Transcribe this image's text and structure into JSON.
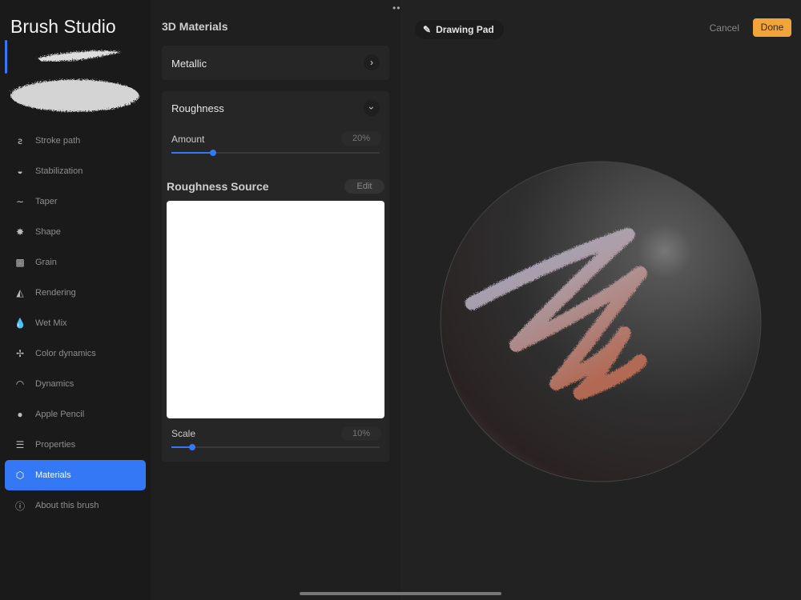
{
  "sidebar": {
    "title": "Brush Studio",
    "items": [
      {
        "label": "Stroke path",
        "icon": "stroke-path-icon",
        "glyph": "ꙅ"
      },
      {
        "label": "Stabilization",
        "icon": "stabilization-icon",
        "glyph": "◒"
      },
      {
        "label": "Taper",
        "icon": "taper-icon",
        "glyph": "∼"
      },
      {
        "label": "Shape",
        "icon": "shape-icon",
        "glyph": "✸"
      },
      {
        "label": "Grain",
        "icon": "grain-icon",
        "glyph": "▩"
      },
      {
        "label": "Rendering",
        "icon": "rendering-icon",
        "glyph": "◭"
      },
      {
        "label": "Wet Mix",
        "icon": "droplet-icon",
        "glyph": "💧"
      },
      {
        "label": "Color dynamics",
        "icon": "pinwheel-icon",
        "glyph": "✢"
      },
      {
        "label": "Dynamics",
        "icon": "gauge-icon",
        "glyph": "◠"
      },
      {
        "label": "Apple Pencil",
        "icon": "pencil-info-icon",
        "glyph": "●"
      },
      {
        "label": "Properties",
        "icon": "list-icon",
        "glyph": "☰"
      },
      {
        "label": "Materials",
        "icon": "cube-icon",
        "glyph": "⬡",
        "active": true
      },
      {
        "label": "About this brush",
        "icon": "info-icon",
        "glyph": "ⓘ"
      }
    ]
  },
  "panel": {
    "title": "3D Materials",
    "metallic": {
      "label": "Metallic"
    },
    "roughness": {
      "label": "Roughness",
      "amount_label": "Amount",
      "amount_value": "20%",
      "amount": 20
    },
    "source": {
      "label": "Roughness Source",
      "edit": "Edit",
      "scale_label": "Scale",
      "scale_value": "10%",
      "scale": 10
    }
  },
  "pad": {
    "title": "Drawing Pad",
    "cancel": "Cancel",
    "done": "Done"
  },
  "colors": {
    "accent": "#3478f6",
    "done": "#f0a43a"
  }
}
